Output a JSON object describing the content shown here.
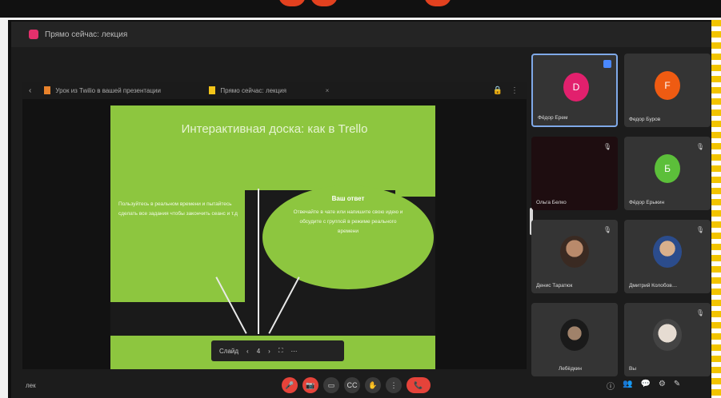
{
  "app": {
    "title": "Прямо сейчас: лекция"
  },
  "tabs": [
    {
      "label": "Урок из Twilio в вашей презентации"
    },
    {
      "label": "Прямо сейчас: лекция"
    }
  ],
  "slide": {
    "title": "Интерактивная доска: как в Trello",
    "left_text": "Пользуйтесь в реальном времени и пытайтесь сделать все задания чтобы закончить сеанс и т.д",
    "ellipse_title": "Ваш ответ",
    "ellipse_text": "Отвечайте в чате или напишите свою идею и обсудите с группой в режиме реального времени"
  },
  "presenter_controls": {
    "page_label": "Слайд",
    "page_value": "4",
    "prev": "‹",
    "next": "›",
    "fit": "⛶",
    "more": "⋯"
  },
  "participants": [
    {
      "name": "Фёдор Ерем",
      "initial": "D",
      "color": "#e2206d",
      "kind": "avatar",
      "selected": true
    },
    {
      "name": "Федор Буров",
      "initial": "F",
      "color": "#ef5b12",
      "kind": "avatar"
    },
    {
      "name": "Ольга Белко",
      "initial": "",
      "color": "#1e0d10",
      "kind": "dark"
    },
    {
      "name": "Фёдор Ерыкин",
      "initial": "Б",
      "color": "#5cbf3a",
      "kind": "avatar"
    },
    {
      "name": "Денис Таратюк",
      "initial": "",
      "color": "",
      "kind": "photo"
    },
    {
      "name": "Дмитрий Колобов…",
      "initial": "",
      "color": "",
      "kind": "photo"
    },
    {
      "name": "Лебёдкин",
      "initial": "",
      "color": "",
      "kind": "photo"
    },
    {
      "name": "Вы",
      "initial": "",
      "color": "",
      "kind": "photo"
    }
  ],
  "controls": {
    "left_label": "лек",
    "buttons": [
      "🎤",
      "📷",
      "▭",
      "CC",
      "✋",
      "⋮"
    ],
    "end": "📞",
    "right": [
      "ⓘ",
      "👥",
      "💬",
      "⚙",
      "✎"
    ]
  }
}
